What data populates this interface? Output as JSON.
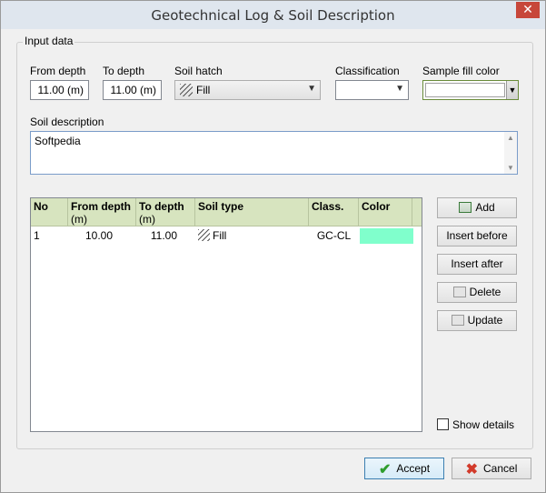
{
  "window": {
    "title": "Geotechnical Log & Soil Description",
    "close_glyph": "✕"
  },
  "input_group": {
    "legend": "Input data"
  },
  "fields": {
    "from_depth": {
      "label": "From depth",
      "value": "11.00 (m)"
    },
    "to_depth": {
      "label": "To depth",
      "value": "11.00 (m)"
    },
    "soil_hatch": {
      "label": "Soil hatch",
      "value": "Fill",
      "icon": "hatch-icon"
    },
    "classification": {
      "label": "Classification",
      "value": ""
    },
    "sample_fill_color": {
      "label": "Sample fill color",
      "value": "#ffffff"
    },
    "soil_description": {
      "label": "Soil description",
      "value": "Softpedia"
    }
  },
  "table": {
    "columns": [
      {
        "title": "No",
        "sub": ""
      },
      {
        "title": "From depth",
        "sub": "(m)"
      },
      {
        "title": "To depth",
        "sub": "(m)"
      },
      {
        "title": "Soil type",
        "sub": ""
      },
      {
        "title": "Class.",
        "sub": ""
      },
      {
        "title": "Color",
        "sub": ""
      }
    ],
    "rows": [
      {
        "no": "1",
        "from_depth": "10.00",
        "to_depth": "11.00",
        "soil_type": "Fill",
        "class": "GC-CL",
        "color": "#80ffcc"
      }
    ]
  },
  "buttons": {
    "add": "Add",
    "insert_before": "Insert before",
    "insert_after": "Insert after",
    "delete": "Delete",
    "update": "Update",
    "accept": "Accept",
    "cancel": "Cancel"
  },
  "show_details": {
    "label": "Show details",
    "checked": false
  },
  "colors": {
    "header_bg": "#d7e4bf",
    "accent": "#3c7fb1",
    "close": "#c7473a"
  }
}
